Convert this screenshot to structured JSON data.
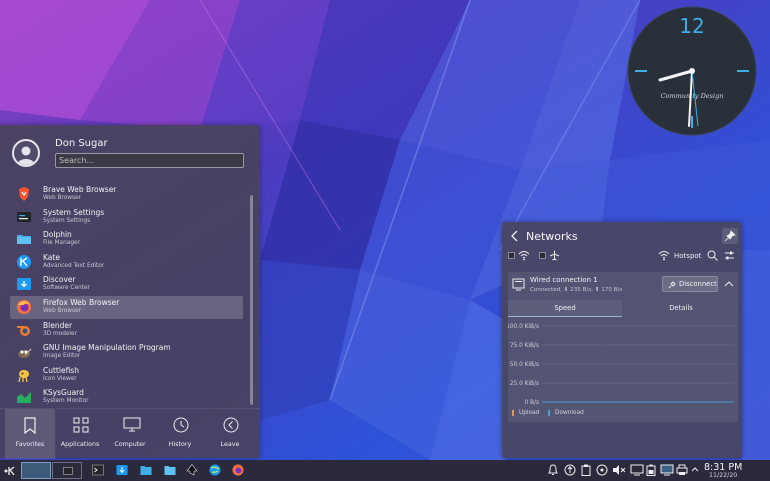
{
  "clock_widget": {
    "number": "12",
    "text": "Community Design"
  },
  "launcher": {
    "user_name": "Don Sugar",
    "search_placeholder": "Search...",
    "apps": [
      {
        "name": "Brave Web Browser",
        "desc": "Web Browser",
        "icon": "brave-icon"
      },
      {
        "name": "System Settings",
        "desc": "System Settings",
        "icon": "settings-icon"
      },
      {
        "name": "Dolphin",
        "desc": "File Manager",
        "icon": "folder-icon"
      },
      {
        "name": "Kate",
        "desc": "Advanced Text Editor",
        "icon": "kate-icon"
      },
      {
        "name": "Discover",
        "desc": "Software Center",
        "icon": "discover-icon"
      },
      {
        "name": "Firefox Web Browser",
        "desc": "Web Browser",
        "icon": "firefox-icon"
      },
      {
        "name": "Blender",
        "desc": "3D modeler",
        "icon": "blender-icon"
      },
      {
        "name": "GNU Image Manipulation Program",
        "desc": "Image Editor",
        "icon": "gimp-icon"
      },
      {
        "name": "Cuttlefish",
        "desc": "Icon Viewer",
        "icon": "cuttlefish-icon"
      },
      {
        "name": "KSysGuard",
        "desc": "System Monitor",
        "icon": "ksysguard-icon"
      }
    ],
    "tabs": [
      {
        "label": "Favorites"
      },
      {
        "label": "Applications"
      },
      {
        "label": "Computer"
      },
      {
        "label": "History"
      },
      {
        "label": "Leave"
      }
    ]
  },
  "networks": {
    "title": "Networks",
    "hotspot_label": "Hotspot",
    "connection": {
      "name": "Wired connection 1",
      "status": "Connected, ⬇ 235 B/s, ⬆ 170 B/s",
      "disconnect_label": "Disconnect"
    },
    "tabs": {
      "speed": "Speed",
      "details": "Details"
    },
    "legend": {
      "upload": "Upload",
      "download": "Download"
    }
  },
  "chart_data": {
    "type": "line",
    "y_ticks": [
      "100.0 KiB/s",
      "75.0 KiB/s",
      "50.0 KiB/s",
      "25.0 KiB/s",
      "0 B/s"
    ],
    "ylim": [
      0,
      100
    ],
    "series": [
      {
        "name": "Upload",
        "values": [
          0,
          0,
          0,
          0,
          0,
          0,
          0,
          0,
          0,
          0
        ]
      },
      {
        "name": "Download",
        "values": [
          0,
          0,
          0,
          0,
          0,
          0,
          0,
          0,
          0,
          0
        ]
      }
    ]
  },
  "taskbar": {
    "time": "8:31 PM",
    "date": "11/22/20"
  },
  "colors": {
    "accent": "#3daee9",
    "upload": "#e8954b",
    "download": "#4c9ad4"
  }
}
